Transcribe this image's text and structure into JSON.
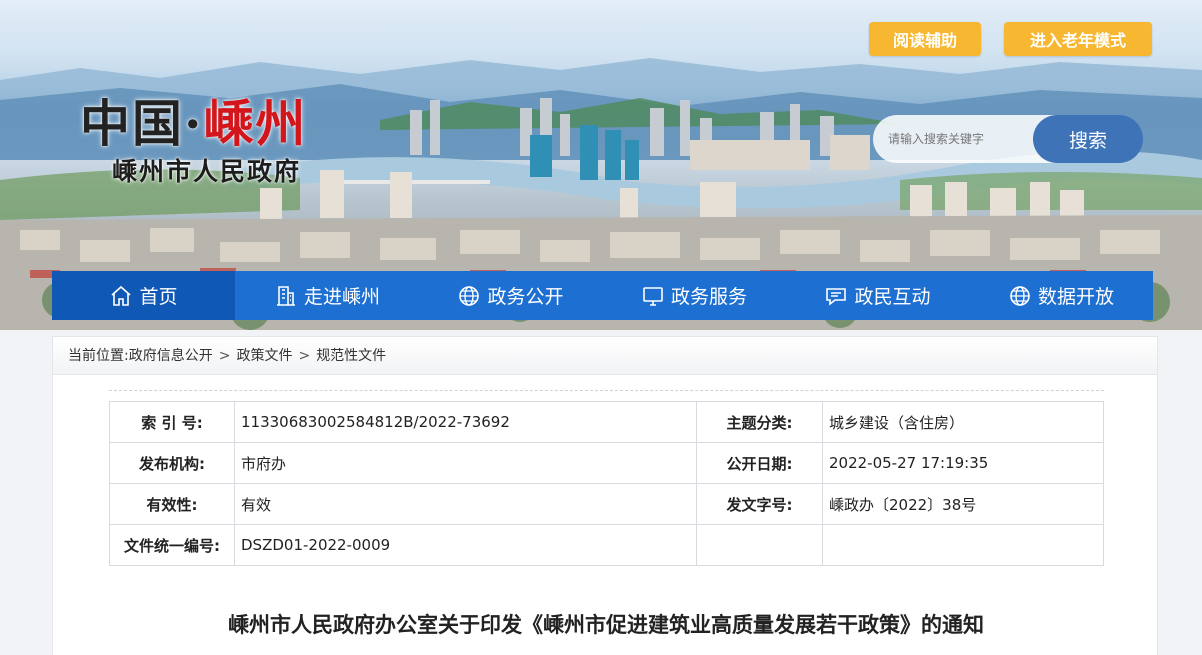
{
  "header": {
    "read_assist": "阅读辅助",
    "elder_mode": "进入老年模式",
    "logo_main_prefix": "中国·",
    "logo_main_city": "嵊州",
    "logo_sub": "嵊州市人民政府",
    "search_placeholder": "请输入搜索关键字",
    "search_button": "搜索"
  },
  "nav": {
    "items": [
      {
        "label": "首页",
        "icon": "home-icon"
      },
      {
        "label": "走进嵊州",
        "icon": "building-icon"
      },
      {
        "label": "政务公开",
        "icon": "globe-icon"
      },
      {
        "label": "政务服务",
        "icon": "monitor-icon"
      },
      {
        "label": "政民互动",
        "icon": "chat-icon"
      },
      {
        "label": "数据开放",
        "icon": "globe-icon"
      }
    ]
  },
  "breadcrumb": {
    "prefix": "当前位置:",
    "items": [
      "政府信息公开",
      "政策文件",
      "规范性文件"
    ]
  },
  "meta": {
    "index_label": "索 引 号:",
    "index_value": "11330683002584812B/2022-73692",
    "topic_label": "主题分类:",
    "topic_value": "城乡建设（含住房）",
    "org_label": "发布机构:",
    "org_value": "市府办",
    "date_label": "公开日期:",
    "date_value": "2022-05-27 17:19:35",
    "validity_label": "有效性:",
    "validity_value": "有效",
    "docno_label": "发文字号:",
    "docno_value": "嵊政办〔2022〕38号",
    "unified_label": "文件统一编号:",
    "unified_value": "DSZD01-2022-0009"
  },
  "document": {
    "title": "嵊州市人民政府办公室关于印发《嵊州市促进建筑业高质量发展若干政策》的通知"
  },
  "colors": {
    "nav_bg": "#1d6fd1",
    "nav_active": "#0f58b6",
    "top_button": "#f7b731",
    "search_button": "#3f73b8",
    "logo_red": "#d2161c"
  }
}
